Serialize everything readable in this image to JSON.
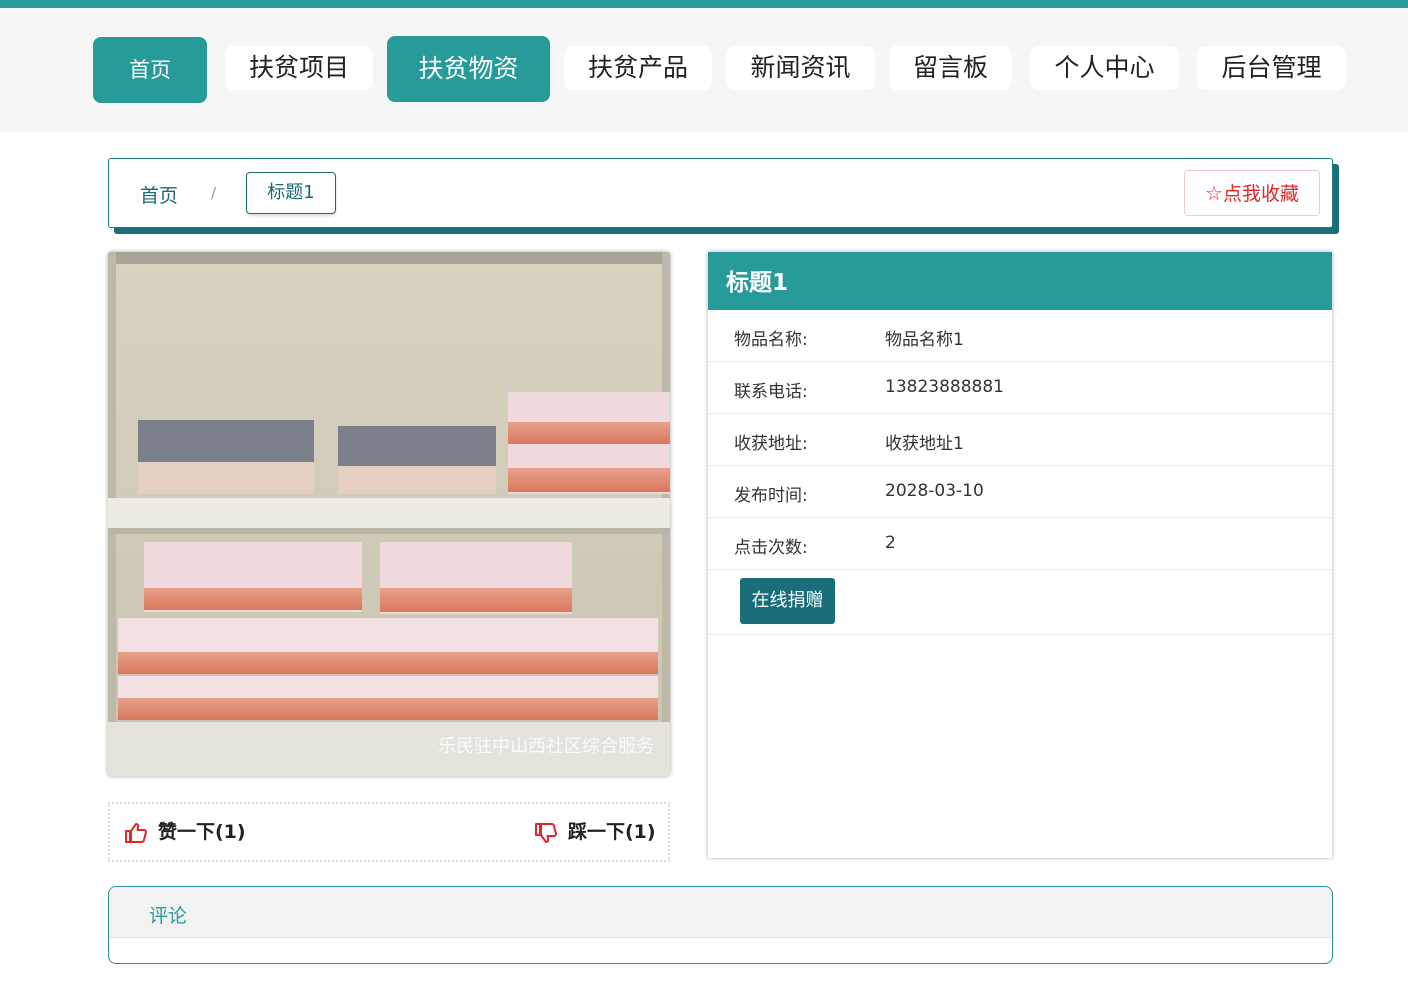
{
  "nav": {
    "items": [
      {
        "label": "首页",
        "active": true
      },
      {
        "label": "扶贫项目",
        "active": false
      },
      {
        "label": "扶贫物资",
        "active": true
      },
      {
        "label": "扶贫产品",
        "active": false
      },
      {
        "label": "新闻资讯",
        "active": false
      },
      {
        "label": "留言板",
        "active": false
      },
      {
        "label": "个人中心",
        "active": false
      },
      {
        "label": "后台管理",
        "active": false
      }
    ]
  },
  "breadcrumb": {
    "home": "首页",
    "separator": "/",
    "current": "标题1"
  },
  "favorite": {
    "icon": "star-outline-icon",
    "label": "点我收藏"
  },
  "photo": {
    "watermark": "乐民驻中山西社区综合服务"
  },
  "votes": {
    "like_label": "赞一下(1)",
    "like_icon": "thumbs-up-icon",
    "dislike_label": "踩一下(1)",
    "dislike_icon": "thumbs-down-icon"
  },
  "detail": {
    "title": "标题1",
    "rows": [
      {
        "key": "物品名称:",
        "value": "物品名称1"
      },
      {
        "key": "联系电话:",
        "value": "13823888881"
      },
      {
        "key": "收获地址:",
        "value": "收获地址1"
      },
      {
        "key": "发布时间:",
        "value": "2028-03-10"
      },
      {
        "key": "点击次数:",
        "value": "2"
      }
    ],
    "donate_label": "在线捐赠"
  },
  "comments": {
    "title": "评论"
  },
  "colors": {
    "accent": "#279a9a",
    "accent_dark": "#1a6e7c",
    "favorite_red": "#e2262a"
  }
}
